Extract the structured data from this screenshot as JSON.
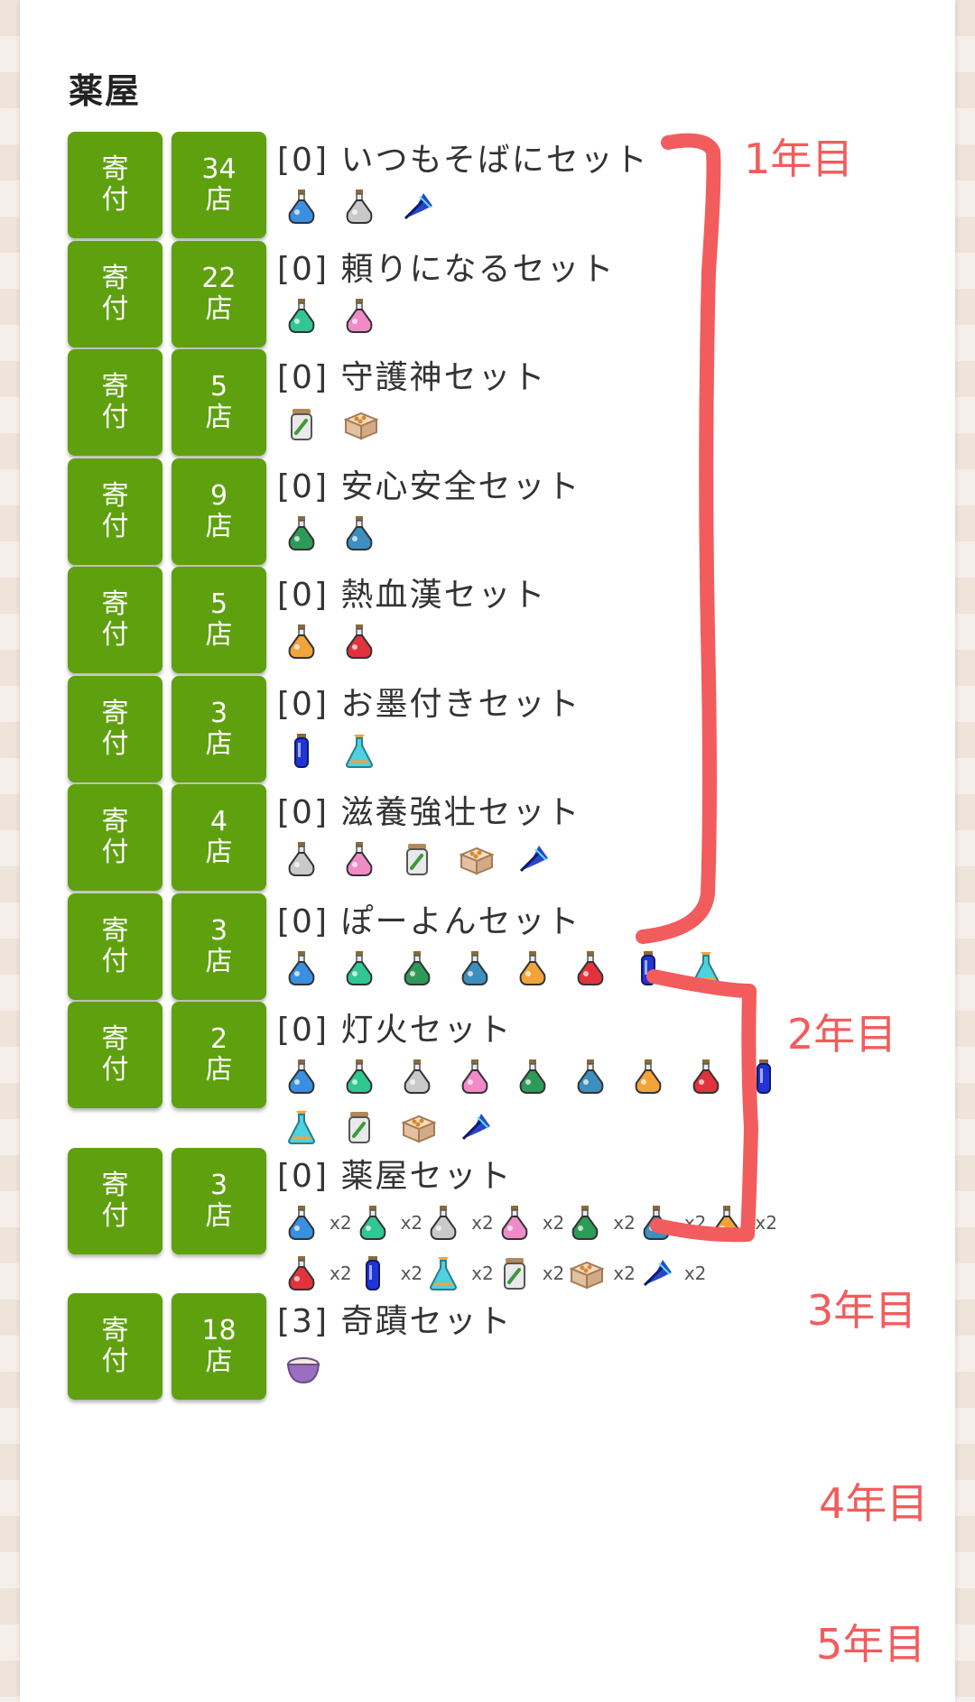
{
  "page": {
    "title": "薬屋"
  },
  "icon_colors": {
    "blue-potion-icon": "#3a8fe0",
    "white-potion-icon": "#c9c9c9",
    "green-potion-icon": "#2fc792",
    "pink-potion-icon": "#f08bc8",
    "darkgreen-potion-icon": "#2e9a58",
    "teal-potion-icon": "#3c8fbf",
    "orange-potion-icon": "#f2a33a",
    "red-potion-icon": "#e2333c",
    "navy-potion-icon": "#2134d6",
    "cyan-flask-icon": "#4fd1e0",
    "jar-icon": "#8f8f8f",
    "box-icon": "#e6c5a6",
    "bluefeather-icon": "#2a46c8",
    "bowl-icon": "#9a6fbf"
  },
  "sets": [
    {
      "donate_label": "寄\n付",
      "shops_label": "34\n店",
      "name": "[0] いつもそばにセット",
      "items": [
        {
          "icon": "blue-potion-icon"
        },
        {
          "icon": "white-potion-icon"
        },
        {
          "icon": "bluefeather-icon"
        }
      ]
    },
    {
      "donate_label": "寄\n付",
      "shops_label": "22\n店",
      "name": "[0] 頼りになるセット",
      "items": [
        {
          "icon": "green-potion-icon"
        },
        {
          "icon": "pink-potion-icon"
        }
      ]
    },
    {
      "donate_label": "寄\n付",
      "shops_label": "5\n店",
      "name": "[0] 守護神セット",
      "items": [
        {
          "icon": "jar-icon"
        },
        {
          "icon": "box-icon"
        }
      ]
    },
    {
      "donate_label": "寄\n付",
      "shops_label": "9\n店",
      "name": "[0] 安心安全セット",
      "items": [
        {
          "icon": "darkgreen-potion-icon"
        },
        {
          "icon": "teal-potion-icon"
        }
      ]
    },
    {
      "donate_label": "寄\n付",
      "shops_label": "5\n店",
      "name": "[0] 熱血漢セット",
      "items": [
        {
          "icon": "orange-potion-icon"
        },
        {
          "icon": "red-potion-icon"
        }
      ]
    },
    {
      "donate_label": "寄\n付",
      "shops_label": "3\n店",
      "name": "[0] お墨付きセット",
      "items": [
        {
          "icon": "navy-potion-icon"
        },
        {
          "icon": "cyan-flask-icon"
        }
      ]
    },
    {
      "donate_label": "寄\n付",
      "shops_label": "4\n店",
      "name": "[0] 滋養強壮セット",
      "items": [
        {
          "icon": "white-potion-icon"
        },
        {
          "icon": "pink-potion-icon"
        },
        {
          "icon": "jar-icon"
        },
        {
          "icon": "box-icon"
        },
        {
          "icon": "bluefeather-icon"
        }
      ]
    },
    {
      "donate_label": "寄\n付",
      "shops_label": "3\n店",
      "name": "[0] ぽーよんセット",
      "items": [
        {
          "icon": "blue-potion-icon"
        },
        {
          "icon": "green-potion-icon"
        },
        {
          "icon": "darkgreen-potion-icon"
        },
        {
          "icon": "teal-potion-icon"
        },
        {
          "icon": "orange-potion-icon"
        },
        {
          "icon": "red-potion-icon"
        },
        {
          "icon": "navy-potion-icon"
        },
        {
          "icon": "cyan-flask-icon"
        }
      ]
    },
    {
      "donate_label": "寄\n付",
      "shops_label": "2\n店",
      "name": "[0] 灯火セット",
      "items": [
        {
          "icon": "blue-potion-icon"
        },
        {
          "icon": "green-potion-icon"
        },
        {
          "icon": "white-potion-icon"
        },
        {
          "icon": "pink-potion-icon"
        },
        {
          "icon": "darkgreen-potion-icon"
        },
        {
          "icon": "teal-potion-icon"
        },
        {
          "icon": "orange-potion-icon"
        },
        {
          "icon": "red-potion-icon"
        },
        {
          "icon": "navy-potion-icon"
        },
        {
          "icon": "cyan-flask-icon"
        },
        {
          "icon": "jar-icon"
        },
        {
          "icon": "box-icon"
        },
        {
          "icon": "bluefeather-icon"
        }
      ]
    },
    {
      "donate_label": "寄\n付",
      "shops_label": "3\n店",
      "name": "[0] 薬屋セット",
      "items": [
        {
          "icon": "blue-potion-icon",
          "qty": "x2"
        },
        {
          "icon": "green-potion-icon",
          "qty": "x2"
        },
        {
          "icon": "white-potion-icon",
          "qty": "x2"
        },
        {
          "icon": "pink-potion-icon",
          "qty": "x2"
        },
        {
          "icon": "darkgreen-potion-icon",
          "qty": "x2"
        },
        {
          "icon": "teal-potion-icon",
          "qty": "x2"
        },
        {
          "icon": "orange-potion-icon",
          "qty": "x2"
        },
        {
          "icon": "red-potion-icon",
          "qty": "x2"
        },
        {
          "icon": "navy-potion-icon",
          "qty": "x2"
        },
        {
          "icon": "cyan-flask-icon",
          "qty": "x2"
        },
        {
          "icon": "jar-icon",
          "qty": "x2"
        },
        {
          "icon": "box-icon",
          "qty": "x2"
        },
        {
          "icon": "bluefeather-icon",
          "qty": "x2"
        }
      ]
    },
    {
      "donate_label": "寄\n付",
      "shops_label": "18\n店",
      "name": "[3] 奇蹟セット",
      "items": [
        {
          "icon": "bowl-icon"
        }
      ]
    }
  ],
  "annotations": [
    "1年目",
    "2年目",
    "3年目",
    "4年目",
    "5年目"
  ],
  "annotation_color": "#f25c5c"
}
